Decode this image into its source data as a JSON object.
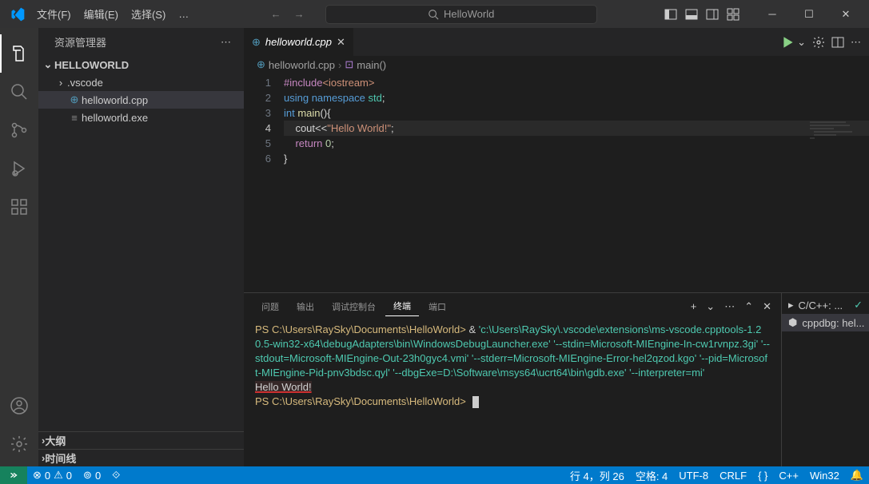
{
  "menu": {
    "file": "文件(F)",
    "edit": "编辑(E)",
    "select": "选择(S)",
    "more": "…"
  },
  "searchCenter": "HelloWorld",
  "sidebar": {
    "title": "资源管理器",
    "root": "HELLOWORLD",
    "items": [
      {
        "label": ".vscode",
        "kind": "folder"
      },
      {
        "label": "helloworld.cpp",
        "kind": "cpp",
        "selected": true
      },
      {
        "label": "helloworld.exe",
        "kind": "exe"
      }
    ],
    "outline": "大纲",
    "timeline": "时间线"
  },
  "tab": {
    "label": "helloworld.cpp"
  },
  "breadcrumb": {
    "file": "helloworld.cpp",
    "symbol": "main()"
  },
  "code": {
    "lines": [
      [
        {
          "c": "k-pp",
          "t": "#include"
        },
        {
          "c": "k-inc",
          "t": "<iostream>"
        }
      ],
      [
        {
          "c": "k-kw",
          "t": "using "
        },
        {
          "c": "k-kw",
          "t": "namespace "
        },
        {
          "c": "k-ns",
          "t": "std"
        },
        {
          "c": "k-op",
          "t": ";"
        }
      ],
      [
        {
          "c": "k-kw",
          "t": "int "
        },
        {
          "c": "k-fn",
          "t": "main"
        },
        {
          "c": "k-op",
          "t": "(){"
        }
      ],
      [
        {
          "c": "k-op",
          "t": "    cout<<"
        },
        {
          "c": "k-str",
          "t": "\"Hello World!\""
        },
        {
          "c": "k-op",
          "t": ";"
        }
      ],
      [
        {
          "c": "k-op",
          "t": "    "
        },
        {
          "c": "k-pp",
          "t": "return "
        },
        {
          "c": "k-num",
          "t": "0"
        },
        {
          "c": "k-op",
          "t": ";"
        }
      ],
      [
        {
          "c": "k-op",
          "t": "}"
        }
      ]
    ],
    "current": 4
  },
  "panel": {
    "tabs": {
      "problems": "问题",
      "output": "输出",
      "debug": "调试控制台",
      "terminal": "终端",
      "ports": "端口"
    },
    "terminal": {
      "prompt1": "PS C:\\Users\\RaySky\\Documents\\HelloWorld>",
      "amp": " & ",
      "cmd": "'c:\\Users\\RaySky\\.vscode\\extensions\\ms-vscode.cpptools-1.20.5-win32-x64\\debugAdapters\\bin\\WindowsDebugLauncher.exe' '--stdin=Microsoft-MIEngine-In-cw1rvnpz.3gi' '--stdout=Microsoft-MIEngine-Out-23h0gyc4.vmi' '--stderr=Microsoft-MIEngine-Error-hel2qzod.kgo' '--pid=Microsoft-MIEngine-Pid-pnv3bdsc.qyl' '--dbgExe=D:\\Software\\msys64\\ucrt64\\bin\\gdb.exe' '--interpreter=mi'",
      "output": "Hello World!",
      "prompt2": "PS C:\\Users\\RaySky\\Documents\\HelloWorld>"
    },
    "side": {
      "cc": "C/C++: ...",
      "dbg": "cppdbg: hel..."
    }
  },
  "status": {
    "errors": "0",
    "warnings": "0",
    "radio": "0",
    "lncol": "行 4，列 26",
    "spaces": "空格: 4",
    "enc": "UTF-8",
    "eol": "CRLF",
    "lang": "C++",
    "brace": "{ }",
    "win": "Win32"
  }
}
